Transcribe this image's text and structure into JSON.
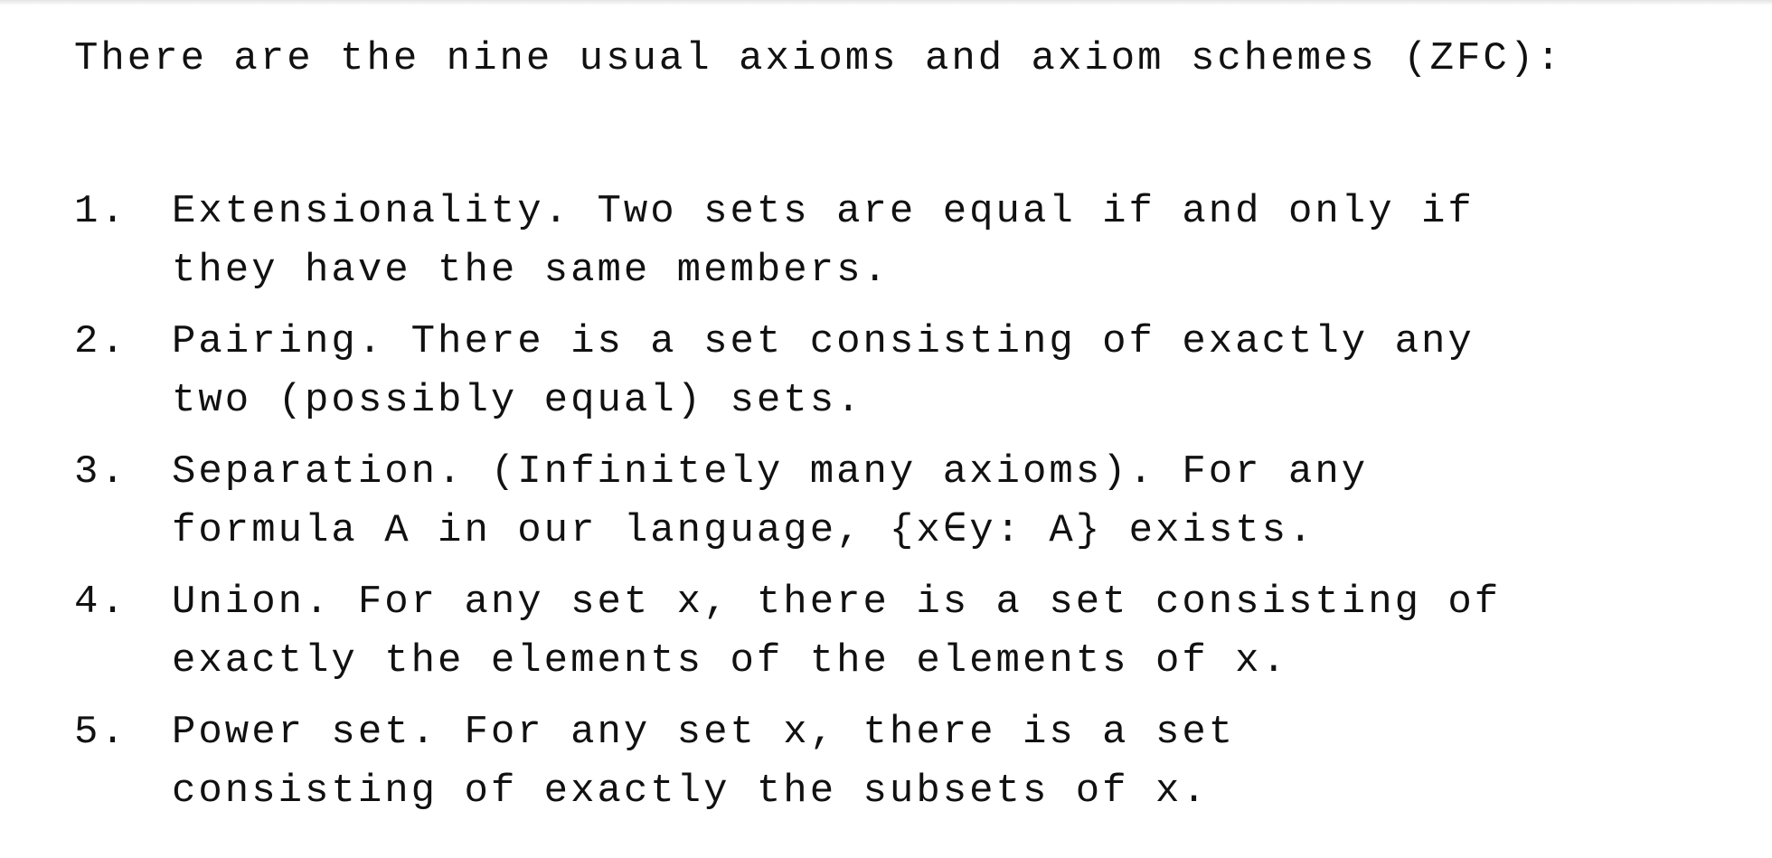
{
  "intro": "There are the nine usual axioms and axiom schemes (ZFC):",
  "axioms": [
    {
      "number": "1.",
      "line1": "Extensionality. Two sets are equal if and only if",
      "line2": "they have the same members."
    },
    {
      "number": "2.",
      "line1": "Pairing. There is a set consisting of exactly any",
      "line2": "two (possibly equal) sets."
    },
    {
      "number": "3.",
      "line1": "Separation. (Infinitely many axioms). For any",
      "line2": "formula A in our language, {x∈y: A} exists."
    },
    {
      "number": "4.",
      "line1": "Union. For any set x, there is a set consisting of",
      "line2": "exactly the elements of the elements of x."
    },
    {
      "number": "5.",
      "line1": "Power set. For any set x, there is a set",
      "line2": "consisting of exactly the subsets of x."
    }
  ]
}
